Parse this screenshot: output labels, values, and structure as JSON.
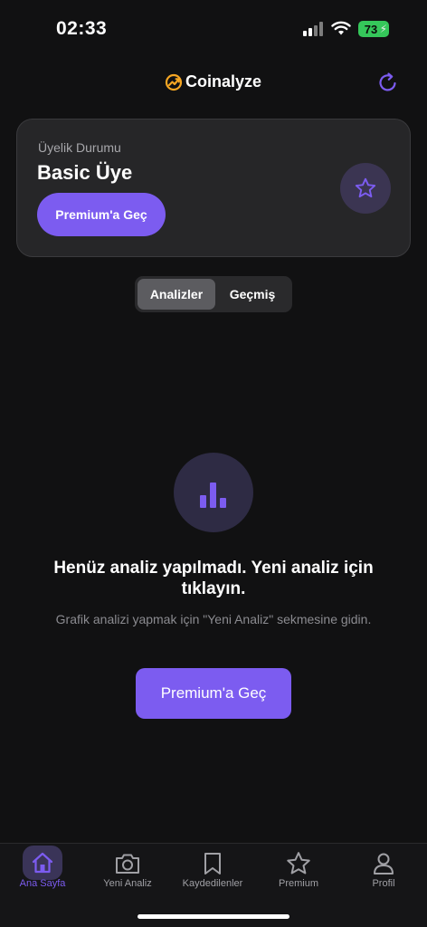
{
  "status_bar": {
    "time": "02:33",
    "battery": "73"
  },
  "header": {
    "brand": "Coinalyze",
    "brand_icon": "chart-growth-icon",
    "refresh_icon": "refresh-icon"
  },
  "membership": {
    "label": "Üyelik Durumu",
    "tier": "Basic Üye",
    "upgrade_label": "Premium'a Geç",
    "badge_icon": "star-icon"
  },
  "segments": {
    "active": "Analizler",
    "inactive": "Geçmiş"
  },
  "empty_state": {
    "icon": "bar-chart-icon",
    "title": "Henüz analiz yapılmadı. Yeni analiz için tıklayın.",
    "subtitle": "Grafik analizi yapmak için \"Yeni Analiz\" sekmesine gidin.",
    "button_label": "Premium'a Geç"
  },
  "tabs": [
    {
      "label": "Ana Sayfa",
      "icon": "home-icon",
      "active": true
    },
    {
      "label": "Yeni Analiz",
      "icon": "camera-icon",
      "active": false
    },
    {
      "label": "Kaydedilenler",
      "icon": "bookmark-icon",
      "active": false
    },
    {
      "label": "Premium",
      "icon": "star-icon",
      "active": false
    },
    {
      "label": "Profil",
      "icon": "person-icon",
      "active": false
    }
  ],
  "colors": {
    "accent": "#7c5cf0",
    "background": "#111112",
    "card": "#262628",
    "brand_icon": "#f5a623",
    "battery": "#35c75a"
  }
}
